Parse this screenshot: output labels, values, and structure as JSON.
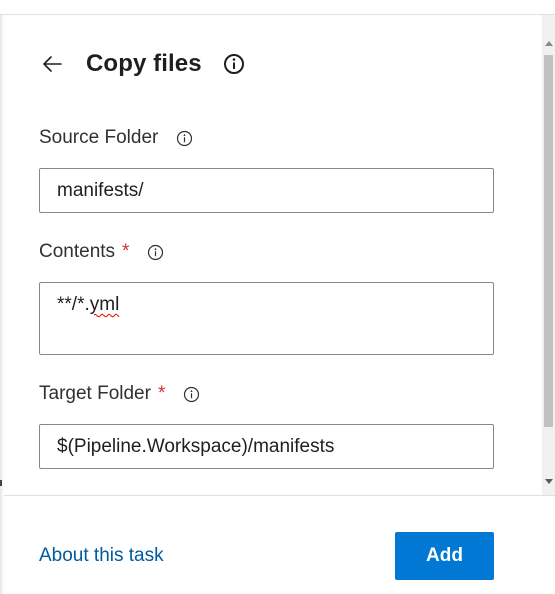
{
  "header": {
    "back_icon": "arrow-left-icon",
    "title": "Copy files",
    "info_icon": "info-icon"
  },
  "fields": {
    "source_folder": {
      "label": "Source Folder",
      "value": "manifests/",
      "required": false
    },
    "contents": {
      "label": "Contents",
      "required_mark": "*",
      "value_prefix": "**/*.",
      "value_misspelled": "yml"
    },
    "target_folder": {
      "label": "Target Folder",
      "required_mark": "*",
      "value": "$(Pipeline.Workspace)/manifests"
    }
  },
  "footer": {
    "about_link": "About this task",
    "add_button": "Add"
  },
  "colors": {
    "accent": "#0078d4",
    "link": "#005a9e",
    "required": "#d13438",
    "spellcheck": "#e00000"
  }
}
